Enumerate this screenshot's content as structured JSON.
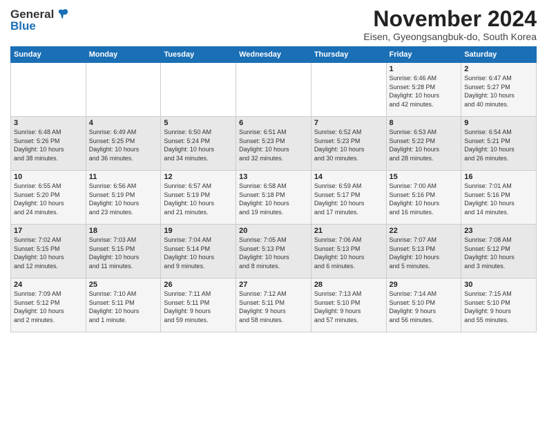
{
  "logo": {
    "general": "General",
    "blue": "Blue"
  },
  "title": "November 2024",
  "location": "Eisen, Gyeongsangbuk-do, South Korea",
  "days_of_week": [
    "Sunday",
    "Monday",
    "Tuesday",
    "Wednesday",
    "Thursday",
    "Friday",
    "Saturday"
  ],
  "weeks": [
    [
      {
        "day": "",
        "info": ""
      },
      {
        "day": "",
        "info": ""
      },
      {
        "day": "",
        "info": ""
      },
      {
        "day": "",
        "info": ""
      },
      {
        "day": "",
        "info": ""
      },
      {
        "day": "1",
        "info": "Sunrise: 6:46 AM\nSunset: 5:28 PM\nDaylight: 10 hours\nand 42 minutes."
      },
      {
        "day": "2",
        "info": "Sunrise: 6:47 AM\nSunset: 5:27 PM\nDaylight: 10 hours\nand 40 minutes."
      }
    ],
    [
      {
        "day": "3",
        "info": "Sunrise: 6:48 AM\nSunset: 5:26 PM\nDaylight: 10 hours\nand 38 minutes."
      },
      {
        "day": "4",
        "info": "Sunrise: 6:49 AM\nSunset: 5:25 PM\nDaylight: 10 hours\nand 36 minutes."
      },
      {
        "day": "5",
        "info": "Sunrise: 6:50 AM\nSunset: 5:24 PM\nDaylight: 10 hours\nand 34 minutes."
      },
      {
        "day": "6",
        "info": "Sunrise: 6:51 AM\nSunset: 5:23 PM\nDaylight: 10 hours\nand 32 minutes."
      },
      {
        "day": "7",
        "info": "Sunrise: 6:52 AM\nSunset: 5:23 PM\nDaylight: 10 hours\nand 30 minutes."
      },
      {
        "day": "8",
        "info": "Sunrise: 6:53 AM\nSunset: 5:22 PM\nDaylight: 10 hours\nand 28 minutes."
      },
      {
        "day": "9",
        "info": "Sunrise: 6:54 AM\nSunset: 5:21 PM\nDaylight: 10 hours\nand 26 minutes."
      }
    ],
    [
      {
        "day": "10",
        "info": "Sunrise: 6:55 AM\nSunset: 5:20 PM\nDaylight: 10 hours\nand 24 minutes."
      },
      {
        "day": "11",
        "info": "Sunrise: 6:56 AM\nSunset: 5:19 PM\nDaylight: 10 hours\nand 23 minutes."
      },
      {
        "day": "12",
        "info": "Sunrise: 6:57 AM\nSunset: 5:19 PM\nDaylight: 10 hours\nand 21 minutes."
      },
      {
        "day": "13",
        "info": "Sunrise: 6:58 AM\nSunset: 5:18 PM\nDaylight: 10 hours\nand 19 minutes."
      },
      {
        "day": "14",
        "info": "Sunrise: 6:59 AM\nSunset: 5:17 PM\nDaylight: 10 hours\nand 17 minutes."
      },
      {
        "day": "15",
        "info": "Sunrise: 7:00 AM\nSunset: 5:16 PM\nDaylight: 10 hours\nand 16 minutes."
      },
      {
        "day": "16",
        "info": "Sunrise: 7:01 AM\nSunset: 5:16 PM\nDaylight: 10 hours\nand 14 minutes."
      }
    ],
    [
      {
        "day": "17",
        "info": "Sunrise: 7:02 AM\nSunset: 5:15 PM\nDaylight: 10 hours\nand 12 minutes."
      },
      {
        "day": "18",
        "info": "Sunrise: 7:03 AM\nSunset: 5:15 PM\nDaylight: 10 hours\nand 11 minutes."
      },
      {
        "day": "19",
        "info": "Sunrise: 7:04 AM\nSunset: 5:14 PM\nDaylight: 10 hours\nand 9 minutes."
      },
      {
        "day": "20",
        "info": "Sunrise: 7:05 AM\nSunset: 5:13 PM\nDaylight: 10 hours\nand 8 minutes."
      },
      {
        "day": "21",
        "info": "Sunrise: 7:06 AM\nSunset: 5:13 PM\nDaylight: 10 hours\nand 6 minutes."
      },
      {
        "day": "22",
        "info": "Sunrise: 7:07 AM\nSunset: 5:13 PM\nDaylight: 10 hours\nand 5 minutes."
      },
      {
        "day": "23",
        "info": "Sunrise: 7:08 AM\nSunset: 5:12 PM\nDaylight: 10 hours\nand 3 minutes."
      }
    ],
    [
      {
        "day": "24",
        "info": "Sunrise: 7:09 AM\nSunset: 5:12 PM\nDaylight: 10 hours\nand 2 minutes."
      },
      {
        "day": "25",
        "info": "Sunrise: 7:10 AM\nSunset: 5:11 PM\nDaylight: 10 hours\nand 1 minute."
      },
      {
        "day": "26",
        "info": "Sunrise: 7:11 AM\nSunset: 5:11 PM\nDaylight: 9 hours\nand 59 minutes."
      },
      {
        "day": "27",
        "info": "Sunrise: 7:12 AM\nSunset: 5:11 PM\nDaylight: 9 hours\nand 58 minutes."
      },
      {
        "day": "28",
        "info": "Sunrise: 7:13 AM\nSunset: 5:10 PM\nDaylight: 9 hours\nand 57 minutes."
      },
      {
        "day": "29",
        "info": "Sunrise: 7:14 AM\nSunset: 5:10 PM\nDaylight: 9 hours\nand 56 minutes."
      },
      {
        "day": "30",
        "info": "Sunrise: 7:15 AM\nSunset: 5:10 PM\nDaylight: 9 hours\nand 55 minutes."
      }
    ]
  ]
}
